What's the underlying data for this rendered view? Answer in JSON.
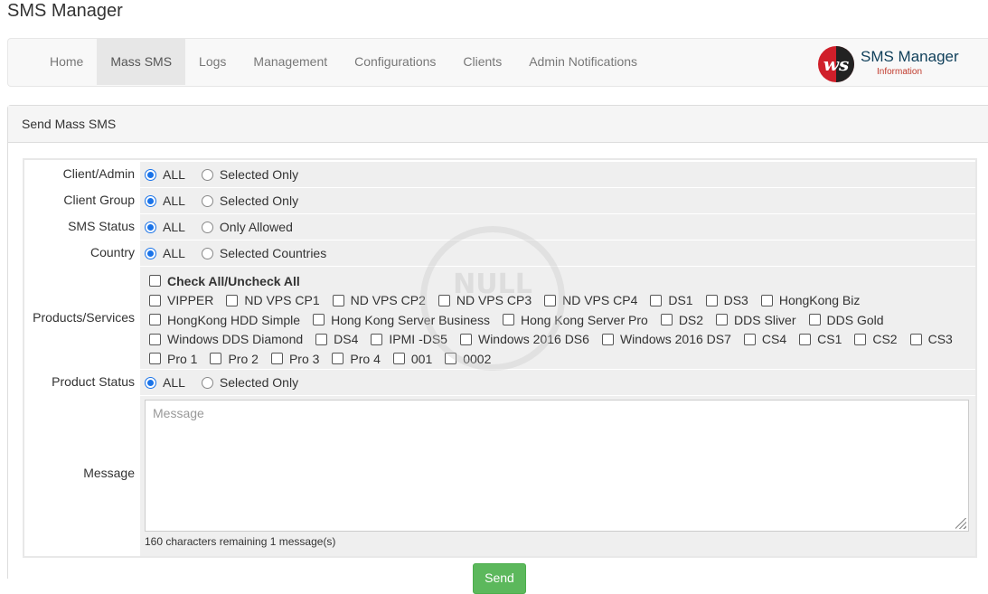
{
  "page_title": "SMS Manager",
  "nav": {
    "items": [
      {
        "label": "Home",
        "active": false
      },
      {
        "label": "Mass SMS",
        "active": true
      },
      {
        "label": "Logs",
        "active": false
      },
      {
        "label": "Management",
        "active": false
      },
      {
        "label": "Configurations",
        "active": false
      },
      {
        "label": "Clients",
        "active": false
      },
      {
        "label": "Admin Notifications",
        "active": false
      }
    ]
  },
  "logo": {
    "glyph": "ws",
    "title": "SMS Manager",
    "subtitle": "Information"
  },
  "panel": {
    "heading": "Send Mass SMS"
  },
  "form": {
    "client_admin": {
      "label": "Client/Admin",
      "options": [
        "ALL",
        "Selected Only"
      ],
      "selected": "ALL"
    },
    "client_group": {
      "label": "Client Group",
      "options": [
        "ALL",
        "Selected Only"
      ],
      "selected": "ALL"
    },
    "sms_status": {
      "label": "SMS Status",
      "options": [
        "ALL",
        "Only Allowed"
      ],
      "selected": "ALL"
    },
    "country": {
      "label": "Country",
      "options": [
        "ALL",
        "Selected Countries"
      ],
      "selected": "ALL"
    },
    "products": {
      "label": "Products/Services",
      "check_all_label": "Check All/Uncheck All",
      "lines": [
        [
          "VIPPER",
          "ND VPS CP1",
          "ND VPS CP2",
          "ND VPS CP3",
          "ND VPS CP4",
          "DS1",
          "DS3",
          "HongKong Biz"
        ],
        [
          "HongKong HDD Simple",
          "Hong Kong Server Business",
          "Hong Kong Server Pro",
          "DS2",
          "DDS Sliver",
          "DDS Gold"
        ],
        [
          "Windows DDS Diamond",
          "DS4",
          "IPMI -DS5",
          "Windows 2016 DS6",
          "Windows 2016 DS7",
          "CS4",
          "CS1",
          "CS2",
          "CS3"
        ],
        [
          "Pro 1",
          "Pro 2",
          "Pro 3",
          "Pro 4",
          "001",
          "0002"
        ]
      ]
    },
    "product_status": {
      "label": "Product Status",
      "options": [
        "ALL",
        "Selected Only"
      ],
      "selected": "ALL"
    },
    "message": {
      "label": "Message",
      "placeholder": "Message",
      "counter": "160 characters remaining 1 message(s)"
    },
    "send_label": "Send"
  },
  "watermark": "NULL",
  "colors": {
    "accent": "#1a73e8",
    "send": "#5cb85c",
    "logo_red": "#d01f2a"
  }
}
